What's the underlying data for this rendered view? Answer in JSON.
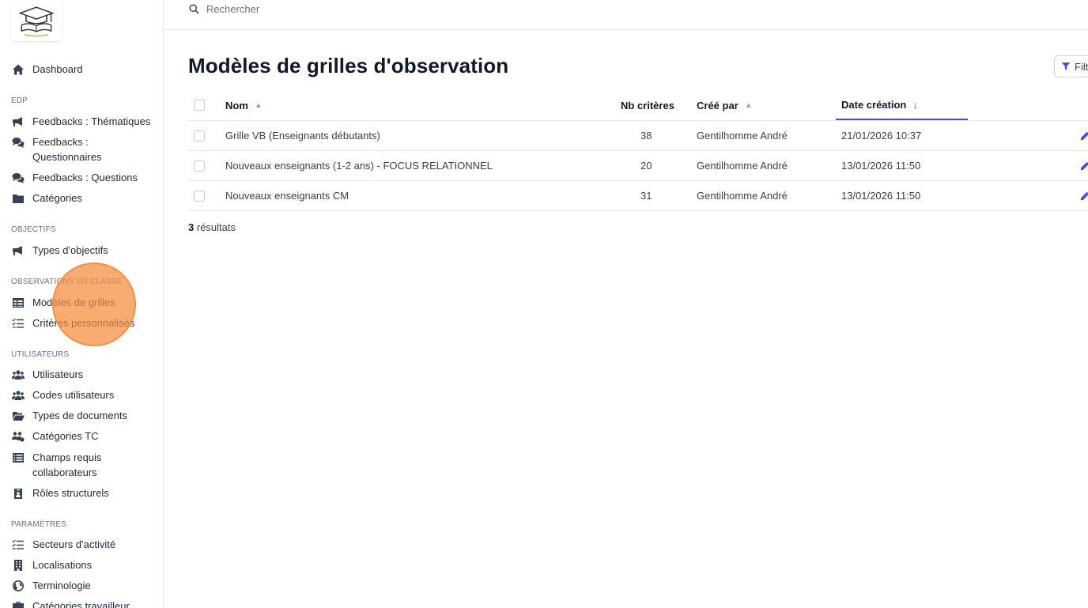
{
  "search": {
    "placeholder": "Rechercher"
  },
  "sidebar": {
    "items": [
      {
        "label": "Dashboard",
        "icon": "home-icon"
      },
      {
        "section": "EDP"
      },
      {
        "label": "Feedbacks : Thématiques",
        "icon": "megaphone-icon"
      },
      {
        "label": "Feedbacks : Questionnaires",
        "icon": "comments-icon"
      },
      {
        "label": "Feedbacks : Questions",
        "icon": "comments-icon"
      },
      {
        "label": "Catégories",
        "icon": "folder-icon"
      },
      {
        "section": "OBJECTIFS"
      },
      {
        "label": "Types d'objectifs",
        "icon": "megaphone-icon"
      },
      {
        "section": "OBSERVATIONS EN CLASSE"
      },
      {
        "label": "Modèles de grilles",
        "icon": "table-icon"
      },
      {
        "label": "Critères personnalisés",
        "icon": "list-check-icon"
      },
      {
        "section": "UTILISATEURS"
      },
      {
        "label": "Utilisateurs",
        "icon": "users-icon"
      },
      {
        "label": "Codes utilisateurs",
        "icon": "users-icon"
      },
      {
        "label": "Types de documents",
        "icon": "folder-open-icon"
      },
      {
        "label": "Catégories TC",
        "icon": "users-gear-icon"
      },
      {
        "label": "Champs requis collaborateurs",
        "icon": "list-icon"
      },
      {
        "label": "Rôles structurels",
        "icon": "id-badge-icon"
      },
      {
        "section": "PARAMÈTRES"
      },
      {
        "label": "Secteurs d'activité",
        "icon": "list-check-icon"
      },
      {
        "label": "Localisations",
        "icon": "building-icon"
      },
      {
        "label": "Terminologie",
        "icon": "globe-icon"
      },
      {
        "label": "Catégories travailleur",
        "icon": "briefcase-icon"
      }
    ]
  },
  "main": {
    "title": "Modèles de grilles d'observation",
    "filter_label": "Filt",
    "columns": {
      "name": "Nom",
      "criteria": "Nb critères",
      "created_by": "Créé par",
      "date": "Date création"
    },
    "rows": [
      {
        "name": "Grille VB (Enseignants débutants)",
        "criteria": "38",
        "created_by": "Gentilhomme André",
        "date": "21/01/2026 10:37"
      },
      {
        "name": "Nouveaux enseignants (1-2 ans) - FOCUS RELATIONNEL",
        "criteria": "20",
        "created_by": "Gentilhomme André",
        "date": "13/01/2026 11:50"
      },
      {
        "name": "Nouveaux enseignants CM",
        "criteria": "31",
        "created_by": "Gentilhomme André",
        "date": "13/01/2026 11:50"
      }
    ],
    "results_count": "3",
    "results_label": "résultats"
  },
  "colors": {
    "accent": "#4f46e5",
    "highlight": "#f58c3c",
    "text": "#1f2937",
    "muted": "#6b7280"
  }
}
